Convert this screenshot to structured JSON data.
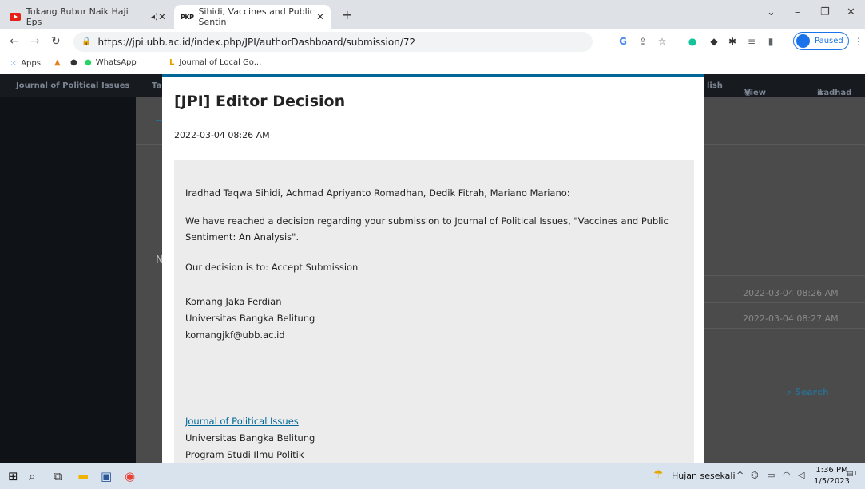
{
  "tabs": [
    {
      "title": "Tukang Bubur Naik Haji Eps",
      "active": false
    },
    {
      "title": "Sihidi, Vaccines and Public Sentin",
      "active": true
    }
  ],
  "tab_new": "+",
  "window_controls": {
    "chevron": "⌄",
    "minimize": "–",
    "restore": "❐",
    "close": "✕"
  },
  "address": {
    "url": "https://jpi.ubb.ac.id/index.php/JPI/authorDashboard/submission/72"
  },
  "profile": {
    "initial": "I",
    "label": "Paused"
  },
  "bookmarks": [
    {
      "label": "Apps"
    },
    {
      "label": "WhatsApp"
    },
    {
      "label": "Journal of Local Go..."
    }
  ],
  "site_nav": {
    "journal": "Journal of Political Issues",
    "partial": "Ta",
    "english": "lish",
    "view_site": "View Site",
    "user": "iradhad"
  },
  "background": {
    "ghost_letter": "N",
    "dates": [
      "2022-03-04 08:26 AM",
      "2022-03-04 08:27 AM"
    ],
    "search": "Search"
  },
  "modal": {
    "title": "[JPI] Editor Decision",
    "date": "2022-03-04 08:26 AM",
    "authors": "Iradhad Taqwa Sihidi, Achmad Apriyanto Romadhan, Dedik Fitrah, Mariano Mariano:",
    "decision_intro": "We have reached a decision regarding your submission to Journal of Political Issues, \"Vaccines and Public Sentiment: An Analysis\".",
    "decision": "Our decision is to: Accept Submission",
    "editor_name": "Komang Jaka Ferdian",
    "editor_affiliation": "Universitas Bangka Belitung",
    "editor_email": "komangjkf@ubb.ac.id",
    "footer_link": "Journal of Political Issues",
    "footer_university": "Universitas Bangka Belitung",
    "footer_program": "Program Studi Ilmu Politik"
  },
  "taskbar": {
    "weather": "Hujan sesekali",
    "time": "1:36 PM",
    "date": "1/5/2023",
    "notification_count": "1"
  },
  "colors": {
    "accent": "#006798",
    "chrome_tabstrip": "#dee1e6",
    "profile_blue": "#1a73e8"
  }
}
